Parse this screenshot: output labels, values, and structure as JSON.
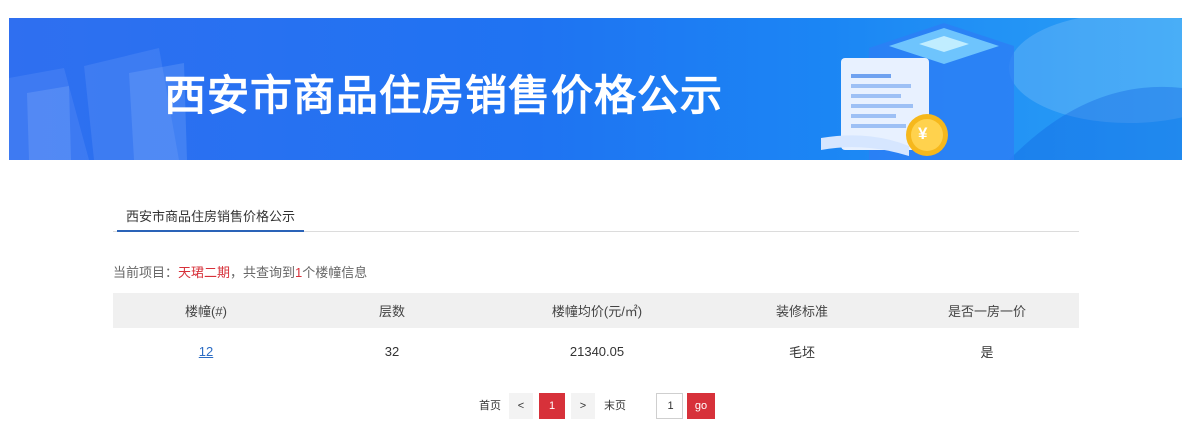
{
  "banner": {
    "title": "西安市商品住房销售价格公示",
    "colors": {
      "start": "#2f6ff0",
      "end": "#2aa0f6"
    },
    "coin_symbol": "¥"
  },
  "tab": {
    "label": "西安市商品住房销售价格公示"
  },
  "info": {
    "prefix": "当前项目：",
    "project": "天珺二期",
    "mid": "，共查询到",
    "count": "1",
    "suffix": "个楼幢信息"
  },
  "table": {
    "headers": [
      "楼幢(#)",
      "层数",
      "楼幢均价(元/㎡)",
      "装修标准",
      "是否一房一价"
    ],
    "rows": [
      {
        "building": "12",
        "floors": "32",
        "avg_price": "21340.05",
        "decoration": "毛坯",
        "one_room_one_price": "是"
      }
    ]
  },
  "pager": {
    "first": "首页",
    "prev": "<",
    "current": "1",
    "next": ">",
    "last": "末页",
    "goto_value": "1",
    "go": "go"
  },
  "colors": {
    "accent_red": "#d7313a",
    "link_blue": "#2b6cc4",
    "tab_underline": "#2a63b8"
  }
}
